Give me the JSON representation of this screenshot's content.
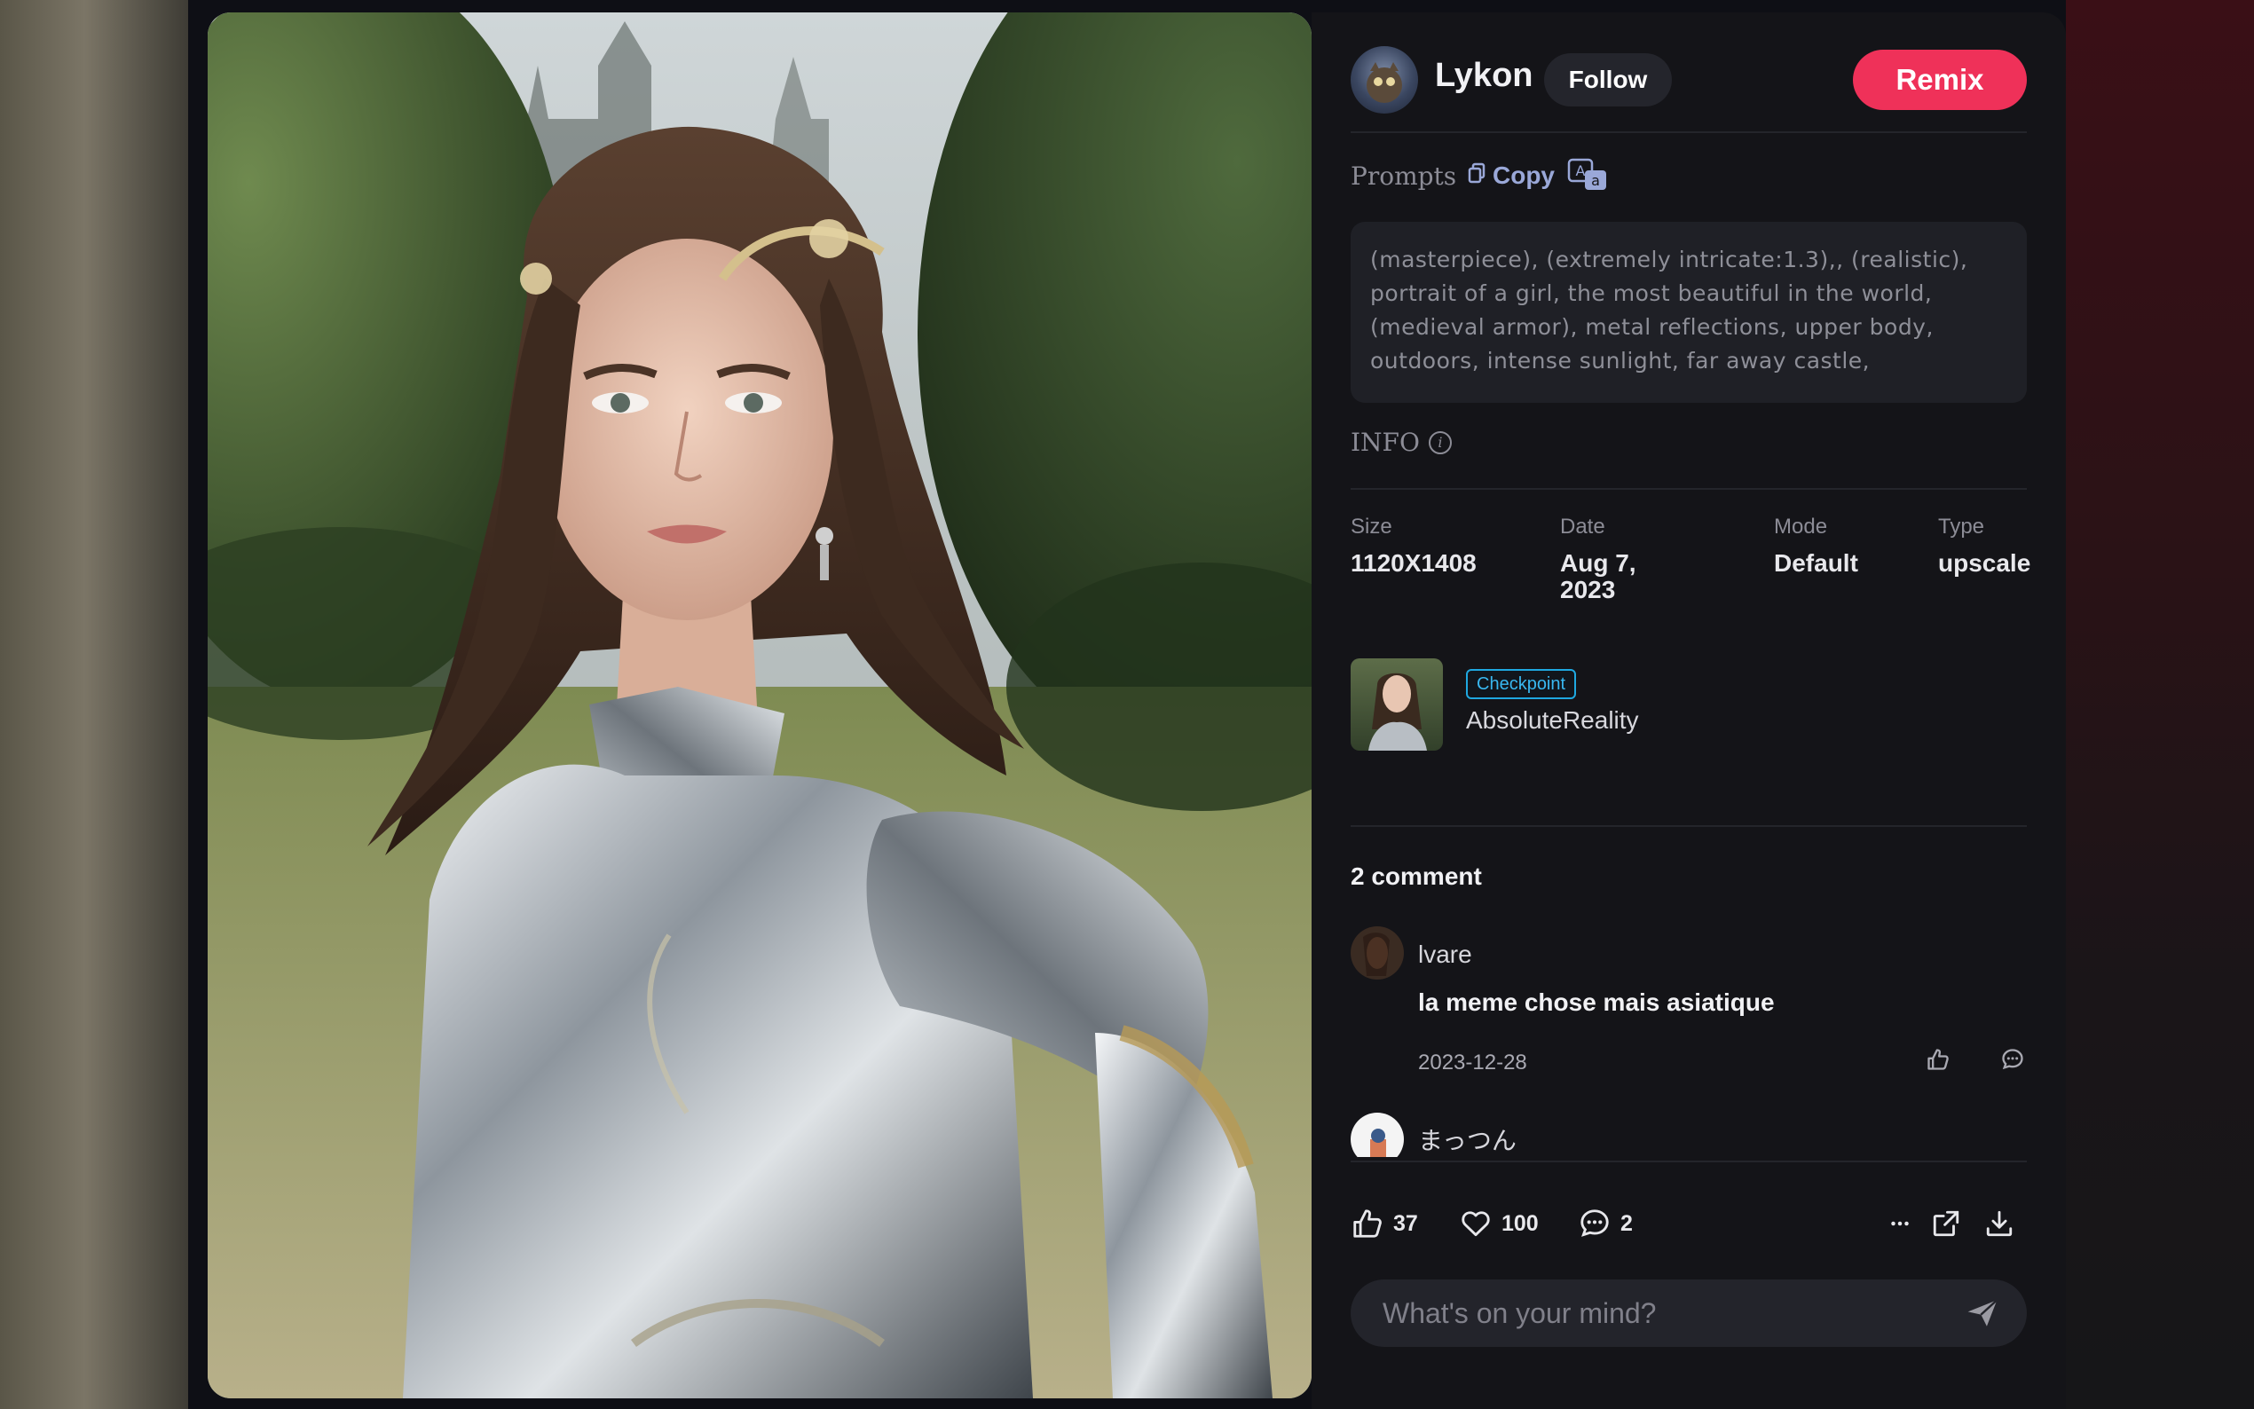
{
  "author": {
    "name": "Lykon",
    "follow_label": "Follow"
  },
  "remix_label": "Remix",
  "prompts": {
    "label": "Prompts",
    "copy_label": "Copy",
    "text": "(masterpiece), (extremely intricate:1.3),, (realistic), portrait of a girl, the most beautiful in the world, (medieval armor), metal reflections, upper body, outdoors, intense sunlight, far away castle,"
  },
  "info": {
    "label": "INFO",
    "size": {
      "label": "Size",
      "value": "1120X1408"
    },
    "date": {
      "label": "Date",
      "value": "Aug 7, 2023"
    },
    "mode": {
      "label": "Mode",
      "value": "Default"
    },
    "type": {
      "label": "Type",
      "value": "upscale"
    }
  },
  "model": {
    "badge": "Checkpoint",
    "name": "AbsoluteReality"
  },
  "comments": {
    "title": "2 comment",
    "items": [
      {
        "user": "lvare",
        "text": "la meme chose mais asiatique",
        "date": "2023-12-28"
      },
      {
        "user": "まっつん"
      }
    ]
  },
  "actions": {
    "likes": "37",
    "favorites": "100",
    "comments": "2"
  },
  "comment_input": {
    "placeholder": "What's on your mind?"
  },
  "colors": {
    "accent": "#ef3159",
    "badge": "#1fa8e0",
    "panel": "#141418"
  }
}
